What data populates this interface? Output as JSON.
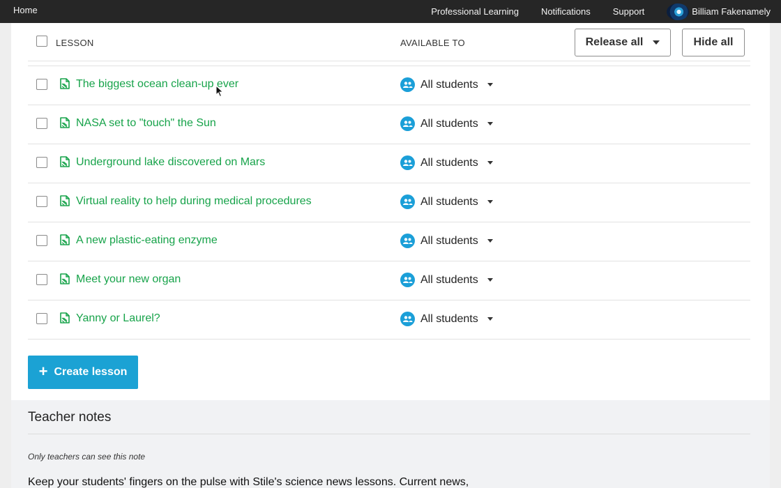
{
  "nav": {
    "home": "Home",
    "links": [
      "Professional Learning",
      "Notifications",
      "Support"
    ],
    "user_name": "Billiam Fakenamely"
  },
  "table": {
    "col_lesson": "LESSON",
    "col_available": "AVAILABLE TO",
    "release_all": "Release all",
    "hide_all": "Hide all",
    "rows": [
      {
        "title": "The biggest ocean clean-up ever",
        "available": "All students"
      },
      {
        "title": "NASA set to \"touch\" the Sun",
        "available": "All students"
      },
      {
        "title": "Underground lake discovered on Mars",
        "available": "All students"
      },
      {
        "title": "Virtual reality to help during medical procedures",
        "available": "All students"
      },
      {
        "title": "A new plastic-eating enzyme",
        "available": "All students"
      },
      {
        "title": "Meet your new organ",
        "available": "All students"
      },
      {
        "title": "Yanny or Laurel?",
        "available": "All students"
      }
    ]
  },
  "create_lesson": "Create lesson",
  "notes": {
    "title": "Teacher notes",
    "subtitle": "Only teachers can see this note",
    "body": "Keep your students' fingers on the pulse with Stile's science news lessons. Current news,"
  },
  "colors": {
    "nav_bg": "#262626",
    "link_green": "#17a34a",
    "accent_blue": "#1ba2d4"
  }
}
